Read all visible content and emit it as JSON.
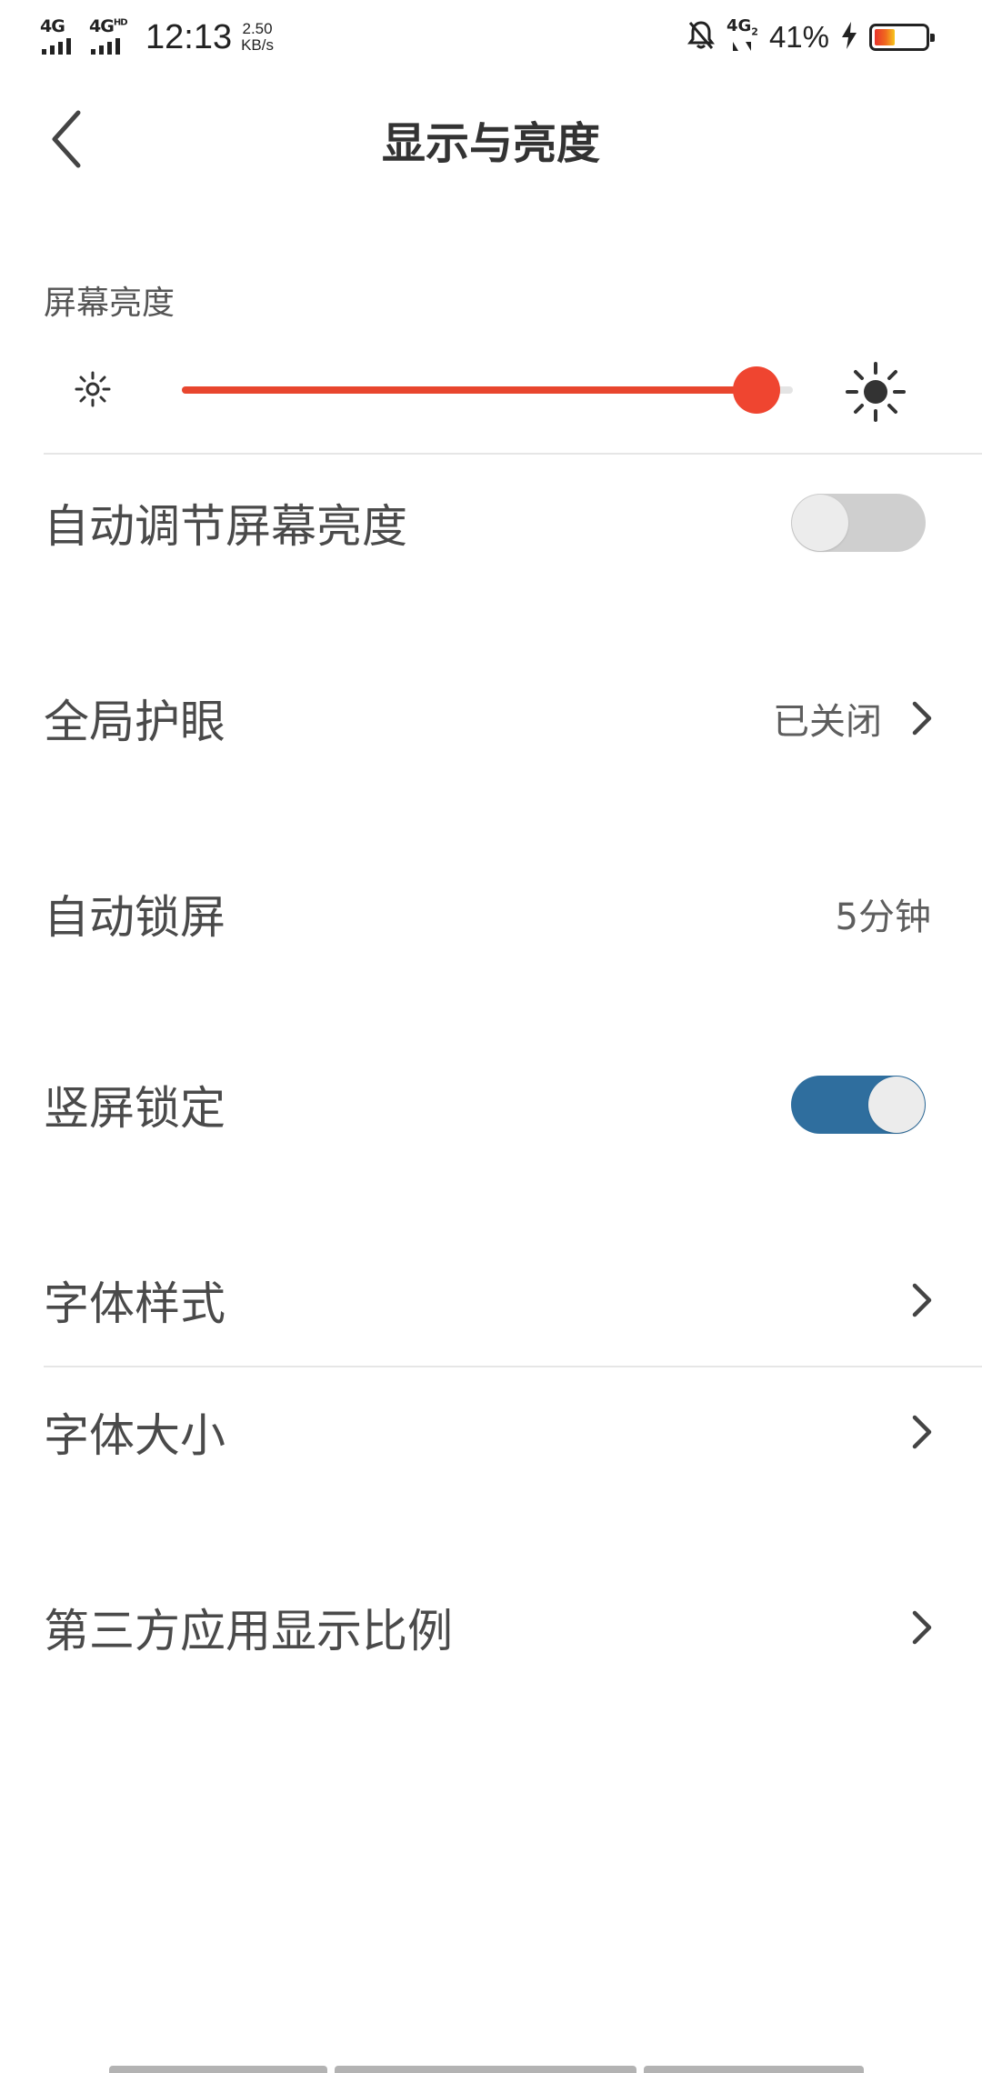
{
  "status_bar": {
    "net1": "4G",
    "net2": "4G",
    "net2_sup": "HD",
    "time": "12:13",
    "speed_value": "2.50",
    "speed_unit": "KB/s",
    "sim2_net": "4G",
    "sim2_sub": "2",
    "battery_percent": "41%",
    "battery_level": 0.41,
    "battery_color": "#e8342c"
  },
  "header": {
    "title": "显示与亮度",
    "back_icon": "chevron-left-icon"
  },
  "brightness": {
    "label": "屏幕亮度",
    "level": 0.94,
    "accent_color": "#ef4530",
    "min_icon": "sun-small-icon",
    "max_icon": "sun-large-icon"
  },
  "settings": {
    "auto_brightness": {
      "label": "自动调节屏幕亮度",
      "enabled": false
    },
    "eye_protection": {
      "label": "全局护眼",
      "value": "已关闭"
    },
    "auto_lock": {
      "label": "自动锁屏",
      "value": "5分钟"
    },
    "portrait_lock": {
      "label": "竖屏锁定",
      "enabled": true,
      "color": "#2f6e9e"
    },
    "font_style": {
      "label": "字体样式"
    },
    "font_size": {
      "label": "字体大小"
    },
    "third_party_ratio": {
      "label": "第三方应用显示比例"
    }
  }
}
